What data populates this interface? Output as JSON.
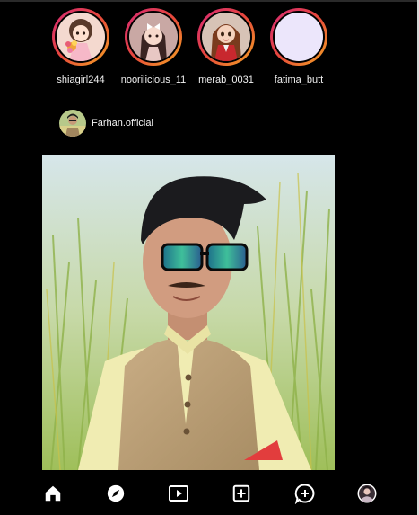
{
  "stories": [
    {
      "username": "shiagirl244",
      "avatar": "cartoon-girl-with-bouquet"
    },
    {
      "username": "noorilicious_11",
      "avatar": "cartoon-girl-with-bow"
    },
    {
      "username": "merab_0031",
      "avatar": "cartoon-girl-red-jacket"
    },
    {
      "username": "fatima_butt",
      "avatar": "blank-lavender"
    }
  ],
  "post": {
    "username": "Farhan.official",
    "image": "man-with-sunglasses-in-wheat-field"
  },
  "nav": {
    "items": [
      {
        "name": "home",
        "icon": "home-icon"
      },
      {
        "name": "explore",
        "icon": "compass-icon"
      },
      {
        "name": "reels",
        "icon": "reels-icon"
      },
      {
        "name": "create",
        "icon": "add-square-icon"
      },
      {
        "name": "messages",
        "icon": "message-plus-icon"
      },
      {
        "name": "profile",
        "icon": "profile-avatar"
      }
    ]
  },
  "colors": {
    "background": "#000000",
    "story_ring_start": "#d62976",
    "story_ring_end": "#f5a623",
    "text": "#f2f2f2"
  }
}
